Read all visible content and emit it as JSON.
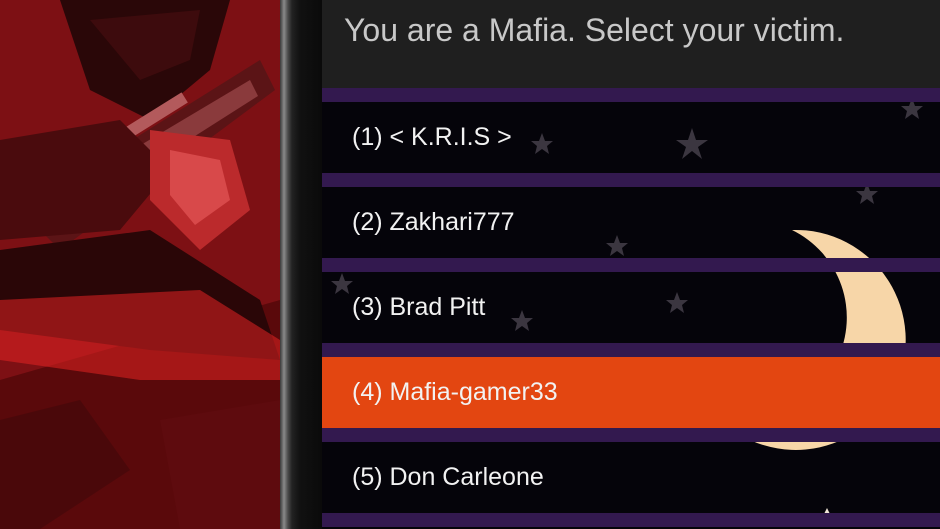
{
  "prompt": {
    "title": "You are a Mafia. Select your victim."
  },
  "players": [
    {
      "label": "(1) < K.R.I.S >",
      "selected": false
    },
    {
      "label": "(2) Zakhari777",
      "selected": false
    },
    {
      "label": "(3) Brad Pitt",
      "selected": false
    },
    {
      "label": "(4) Mafia-gamer33",
      "selected": true
    },
    {
      "label": "(5) Don Carleone",
      "selected": false
    }
  ],
  "colors": {
    "selected_row": "#e34611",
    "stripe": "#33194f",
    "header_bg": "#1f1f1f",
    "art_red": "#7a0e10"
  },
  "icons": {
    "background_moon": "crescent-moon-icon",
    "background_stars": "star-icon"
  }
}
